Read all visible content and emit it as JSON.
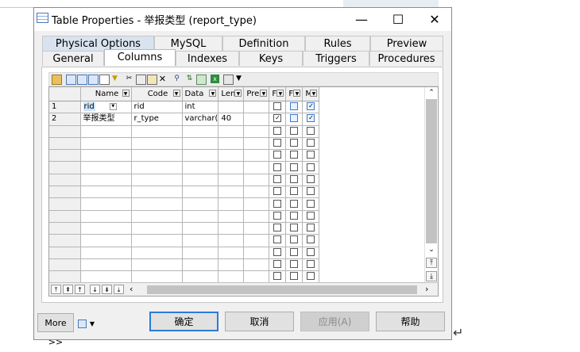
{
  "window": {
    "title": "Table Properties - 举报类型 (report_type)",
    "minimize_glyph": "—",
    "maximize_glyph": "☐",
    "close_glyph": "✕"
  },
  "tabs_row1": [
    "Physical Options",
    "MySQL",
    "Definition",
    "Rules",
    "Preview"
  ],
  "tabs_row2": [
    "General",
    "Columns",
    "Indexes",
    "Keys",
    "Triggers",
    "Procedures"
  ],
  "active_tab": "Columns",
  "toolbar": {
    "icons": [
      "properties-icon",
      "insert-row-icon",
      "add-row-icon",
      "add-columns-icon",
      "copy-icon",
      "filter-icon",
      "cut-icon",
      "copy-icon",
      "paste-icon",
      "delete-icon",
      "find-icon",
      "sort-icon",
      "customize-columns-icon",
      "excel-export-icon",
      "print-icon",
      "dropdown-arrow-icon"
    ]
  },
  "grid": {
    "headers": [
      "Name",
      "Code",
      "Data",
      "Len",
      "Pre",
      "F",
      "F",
      "M"
    ],
    "rows": [
      {
        "num": "1",
        "name": "rid",
        "code": "rid",
        "data": "int",
        "len": "",
        "pre": "",
        "p": false,
        "f": false,
        "m": true
      },
      {
        "num": "2",
        "name": "举报类型",
        "code": "r_type",
        "data": "varchar(",
        "len": "40",
        "pre": "",
        "p": true,
        "f": false,
        "m": true
      }
    ],
    "empty_rows": 14
  },
  "nav_buttons": [
    "⤒",
    "⇞",
    "↑",
    "↓",
    "⇟",
    "⤓"
  ],
  "buttons": {
    "more": "More >>",
    "ok": "确定",
    "cancel": "取消",
    "apply": "应用(A)",
    "help": "帮助"
  },
  "colors": {
    "accent": "#2b7bd6",
    "tab_highlight": "#d9e3f0",
    "scroll_thumb": "#c2c2c2"
  }
}
